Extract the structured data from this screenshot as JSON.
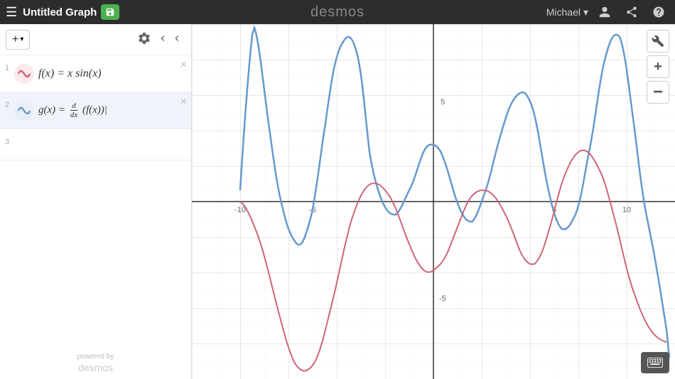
{
  "header": {
    "menu_icon": "☰",
    "title": "Untitled Graph",
    "save_icon": "save",
    "logo": "desmos",
    "user_name": "Michael",
    "user_chevron": "▾",
    "icon_account": "person",
    "icon_share": "share",
    "icon_help": "?"
  },
  "left_panel": {
    "add_button_label": "+ ▾",
    "gear_icon": "gear",
    "collapse_icon": "chevron-left",
    "expressions": [
      {
        "id": 1,
        "row_number": "1",
        "color": "#cc6677",
        "formula_display": "f(x) = x sin(x)",
        "formula_raw": "f(x) = x\\sin(x)"
      },
      {
        "id": 2,
        "row_number": "2",
        "color": "#6699cc",
        "formula_display": "g(x) = d/dx (f(x))",
        "formula_raw": "g(x) = \\frac{d}{dx}(f(x))"
      },
      {
        "id": 3,
        "row_number": "3",
        "color": "#888",
        "formula_display": "",
        "formula_raw": ""
      }
    ],
    "powered_by": "powered by",
    "powered_by_logo": "desmos"
  },
  "graph": {
    "x_min": -10,
    "x_max": 10,
    "y_min": -8,
    "y_max": 8,
    "x_labels": [
      "-10",
      "-5",
      "5",
      "10"
    ],
    "y_labels": [
      "5",
      "-5"
    ],
    "zoom_in": "+",
    "zoom_out": "−",
    "wrench_icon": "wrench"
  }
}
